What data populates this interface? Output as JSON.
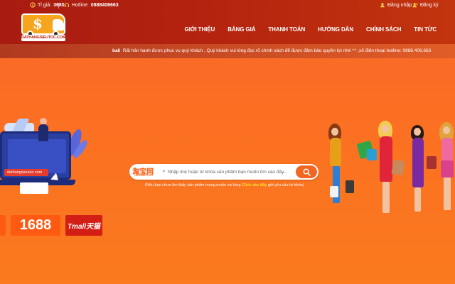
{
  "colors": {
    "header_bg": "#b4230f",
    "hero_bg": "#fb6f22",
    "accent": "#f26623",
    "link_yellow": "#ffe02b"
  },
  "info_bar": {
    "exchange_label": "Tỉ giá:",
    "exchange_value": "3680",
    "hotline_label": "Hotline:",
    "hotline_value": "0888406663",
    "login": "Đăng nhập",
    "register": "Đăng ký"
  },
  "logo": {
    "text": "DATHANGSIEUTOC.COM"
  },
  "nav": {
    "items": [
      {
        "label": "GIỚI THIỆU"
      },
      {
        "label": "BẢNG GIÁ"
      },
      {
        "label": "THANH TOÁN"
      },
      {
        "label": "HƯỚNG DẪN"
      },
      {
        "label": "CHÍNH SÁCH"
      },
      {
        "label": "TIN TỨC"
      }
    ]
  },
  "ticker": {
    "prefix": "bali",
    "text": "Rất hân hạnh được phục vụ quý khách , Quý khách vui lòng đọc rõ chính sách để được đảm bảo quyền lợi nhé ^^ ,số điện thoại hotline: 0888.406.663"
  },
  "hero": {
    "illustration_url": "dathangsieutoc.com"
  },
  "search": {
    "brand_cn": "淘宝网",
    "brand_en": "Taobao.com",
    "placeholder": "Nhập link hoặc từ khóa sản phẩm bạn muốn tìm vào đây...",
    "note_before": "(Nếu bạn chưa tìm thấy sản phẩm mong muốn vui lòng",
    "note_link": "Click vào đây",
    "note_after": "gửi yêu cầu từ khóa)"
  },
  "marketplaces": {
    "l1688": "1688",
    "tmall": "Tmall天猫"
  }
}
